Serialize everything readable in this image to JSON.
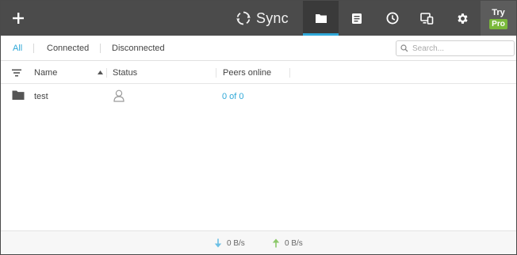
{
  "app": {
    "brand": "Sync"
  },
  "topbar": {
    "add_icon": "plus-icon",
    "nav": [
      {
        "name": "folders",
        "icon": "folder-icon",
        "active": true
      },
      {
        "name": "notes",
        "icon": "notes-icon",
        "active": false
      },
      {
        "name": "history",
        "icon": "clock-icon",
        "active": false
      },
      {
        "name": "devices",
        "icon": "devices-icon",
        "active": false
      },
      {
        "name": "settings",
        "icon": "gear-icon",
        "active": false
      }
    ],
    "try_label": "Try",
    "pro_label": "Pro"
  },
  "filters": {
    "tabs": [
      {
        "label": "All",
        "active": true
      },
      {
        "label": "Connected",
        "active": false
      },
      {
        "label": "Disconnected",
        "active": false
      }
    ],
    "search_placeholder": "Search...",
    "search_value": ""
  },
  "table": {
    "columns": [
      "Name",
      "Status",
      "Peers online"
    ],
    "sort_column": "Name",
    "rows": [
      {
        "name": "test",
        "status_icon": "user-icon",
        "peers": "0 of 0"
      }
    ]
  },
  "footer": {
    "download_rate": "0 B/s",
    "upload_rate": "0 B/s"
  },
  "colors": {
    "accent": "#2fa8d8",
    "toolbar": "#4b4b4b",
    "pro_badge": "#7ab83a",
    "download_arrow": "#6cc0e5",
    "upload_arrow": "#8cc86a"
  }
}
